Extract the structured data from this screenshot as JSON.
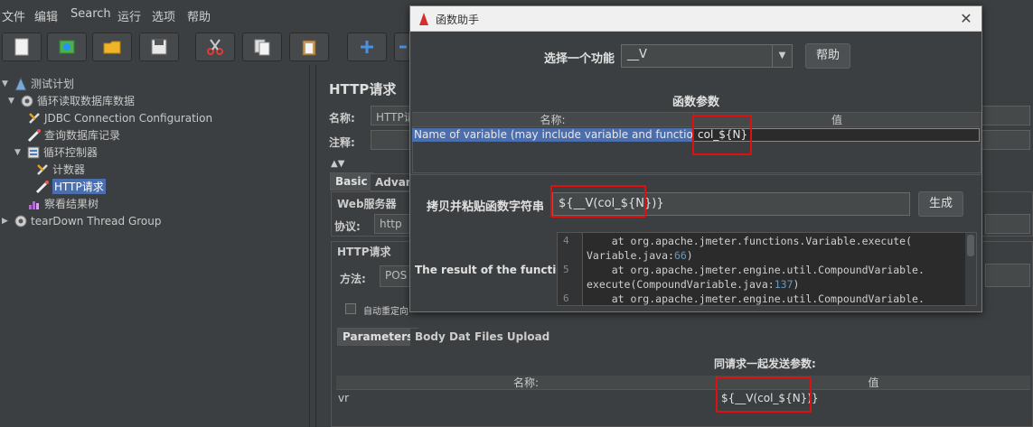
{
  "menubar": {
    "items": [
      "文件",
      "编辑",
      "Search",
      "运行",
      "选项",
      "帮助"
    ]
  },
  "toolbar": {
    "buttons": [
      "new-icon",
      "templates-icon",
      "open-icon",
      "save-icon",
      "cut-icon",
      "copy-icon",
      "paste-icon",
      "expand-icon",
      "collapse-icon"
    ],
    "plus_label": "+"
  },
  "tree": {
    "items": [
      {
        "label": "测试计划",
        "icon": "test-plan-icon",
        "indent": 0,
        "arrow": "▼"
      },
      {
        "label": "循环读取数据库数据",
        "icon": "thread-group-icon",
        "indent": 1,
        "arrow": "▼"
      },
      {
        "label": "JDBC Connection Configuration",
        "icon": "config-icon",
        "indent": 2,
        "arrow": ""
      },
      {
        "label": "查询数据库记录",
        "icon": "sampler-icon",
        "indent": 2,
        "arrow": ""
      },
      {
        "label": "循环控制器",
        "icon": "controller-icon",
        "indent": 2,
        "arrow": "▼"
      },
      {
        "label": "计数器",
        "icon": "config-icon",
        "indent": 3,
        "arrow": ""
      },
      {
        "label": "HTTP请求",
        "icon": "sampler-icon",
        "indent": 3,
        "arrow": "",
        "selected": true
      },
      {
        "label": "察看结果树",
        "icon": "listener-icon",
        "indent": 2,
        "arrow": ""
      },
      {
        "label": "tearDown Thread Group",
        "icon": "thread-group-icon",
        "indent": 0,
        "arrow": "▶"
      }
    ]
  },
  "http_panel": {
    "title": "HTTP请求",
    "name_label": "名称:",
    "name_value": "HTTP请",
    "comment_label": "注释:",
    "tabs": [
      "Basic",
      "Advanc"
    ],
    "web_server_label": "Web服务器",
    "protocol_label": "协议:",
    "protocol_value": "http",
    "http_request_label": "HTTP请求",
    "method_label": "方法:",
    "method_value": "POS",
    "auto_redirect_label": "自动重定向",
    "params_tabs": [
      "Parameters",
      "Body Data",
      "Files Upload"
    ],
    "params_header": "同请求一起发送参数:",
    "col_name": "名称:",
    "col_value": "值",
    "rows": [
      {
        "name": "vr",
        "value": "${__V(col_${N})}"
      }
    ]
  },
  "dialog": {
    "title": "函数助手",
    "function_label": "选择一个功能",
    "function_value": "__V",
    "help_button": "帮助",
    "params_title": "函数参数",
    "col_name": "名称:",
    "col_value": "值",
    "param_rows": [
      {
        "name": "Name of variable (may include variable and function ref...",
        "value": "col_${N}"
      }
    ],
    "copy_label": "拷贝并粘贴函数字符串",
    "function_string": "${__V(col_${N})}",
    "generate_button": "生成",
    "result_label": "The result of the function is",
    "code_lines": [
      {
        "no": "4",
        "text": "    at org.apache.jmeter.functions.Variable.execute("
      },
      {
        "no": "",
        "text": "Variable.java:",
        "num": "66",
        "tail": ")"
      },
      {
        "no": "5",
        "text": "    at org.apache.jmeter.engine.util.CompoundVariable."
      },
      {
        "no": "",
        "text": "execute(CompoundVariable.java:",
        "num": "137",
        "tail": ")"
      },
      {
        "no": "6",
        "text": "    at org.apache.jmeter.engine.util.CompoundVariable."
      }
    ]
  },
  "colors": {
    "background": "#3c3f41",
    "selection": "#4b6eaf",
    "highlight_box": "#e01010"
  }
}
